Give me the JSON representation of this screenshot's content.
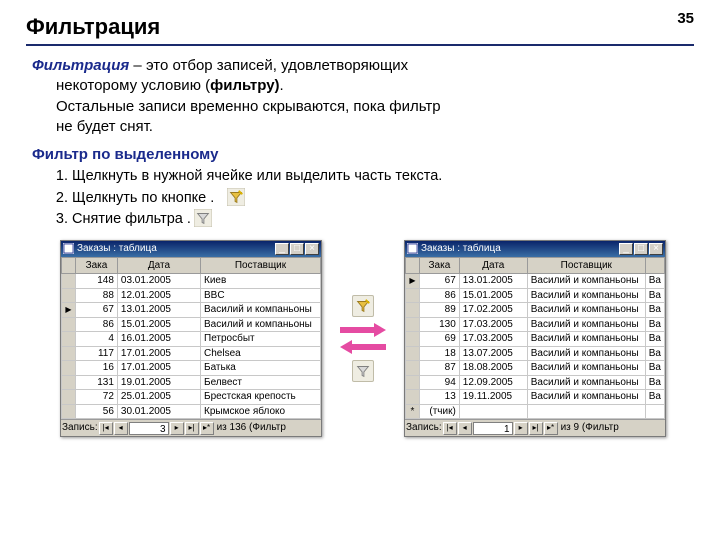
{
  "page_number": "35",
  "title": "Фильтрация",
  "para": {
    "term": "Фильтрация",
    "l1": " – это отбор записей, удовлетворяющих",
    "l2": "некоторому условию (",
    "bold_filter": "фильтру)",
    "l2b": ".",
    "l3": "Остальные записи временно скрываются, пока фильтр",
    "l4": "не будет снят."
  },
  "subhead": "Фильтр по выделенному",
  "steps": [
    "Щелкнуть в нужной ячейке или выделить часть текста.",
    "Щелкнуть по кнопке          .",
    "Снятие фильтра           ."
  ],
  "inline_icons": {
    "apply": "filter-apply-icon",
    "remove": "filter-remove-icon"
  },
  "window_left": {
    "title": "Заказы : таблица",
    "cols": [
      "Зака",
      "Дата",
      "Поставщик"
    ],
    "rows": [
      [
        "148",
        "03.01.2005",
        "Киев"
      ],
      [
        "88",
        "12.01.2005",
        "BBC"
      ],
      [
        "67",
        "13.01.2005",
        "Василий и компаньоны"
      ],
      [
        "86",
        "15.01.2005",
        "Василий и компаньоны"
      ],
      [
        "4",
        "16.01.2005",
        "Петросбыт"
      ],
      [
        "117",
        "17.01.2005",
        "Chelsea"
      ],
      [
        "16",
        "17.01.2005",
        "Батька"
      ],
      [
        "131",
        "19.01.2005",
        "Белвест"
      ],
      [
        "72",
        "25.01.2005",
        "Брестская крепость"
      ],
      [
        "56",
        "30.01.2005",
        "Крымское яблоко"
      ]
    ],
    "nav": {
      "label": "Запись:",
      "pos": "3",
      "total": "из 136  (Фильтр"
    }
  },
  "window_right": {
    "title": "Заказы : таблица",
    "cols": [
      "Зака",
      "Дата",
      "Поставщик",
      ""
    ],
    "rows": [
      [
        "67",
        "13.01.2005",
        "Василий и компаньоны",
        "Ва"
      ],
      [
        "86",
        "15.01.2005",
        "Василий и компаньоны",
        "Ва"
      ],
      [
        "89",
        "17.02.2005",
        "Василий и компаньоны",
        "Ва"
      ],
      [
        "130",
        "17.03.2005",
        "Василий и компаньоны",
        "Ва"
      ],
      [
        "69",
        "17.03.2005",
        "Василий и компаньоны",
        "Ва"
      ],
      [
        "18",
        "13.07.2005",
        "Василий и компаньоны",
        "Ва"
      ],
      [
        "87",
        "18.08.2005",
        "Василий и компаньоны",
        "Ва"
      ],
      [
        "94",
        "12.09.2005",
        "Василий и компаньоны",
        "Ва"
      ],
      [
        "13",
        "19.11.2005",
        "Василий и компаньоны",
        "Ва"
      ]
    ],
    "newrow_marker": "*",
    "newrow_text": "(тчик)",
    "nav": {
      "label": "Запись:",
      "pos": "1",
      "total": "из 9  (Фильтр"
    }
  }
}
